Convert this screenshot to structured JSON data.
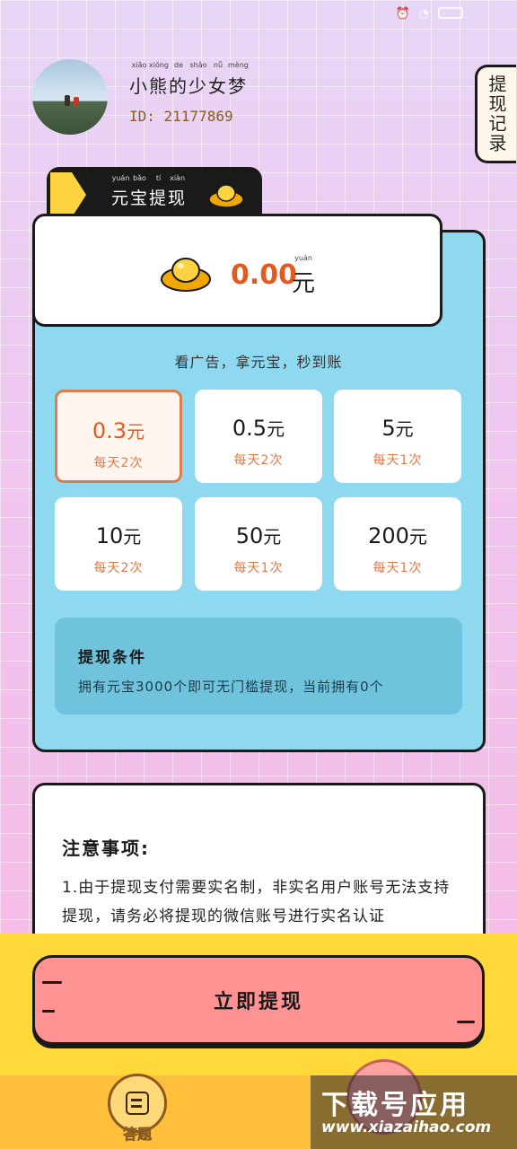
{
  "profile": {
    "name": "小熊的少女梦",
    "name_pinyin": [
      "xiǎo",
      "xióng",
      "de",
      "shǎo",
      "nǚ",
      "mèng"
    ],
    "id_label": "ID: 21177869"
  },
  "header": {
    "record_button": "提现记录"
  },
  "section": {
    "title": "元宝提现",
    "title_pinyin": [
      "yuán",
      "bǎo",
      "tí",
      "xiàn"
    ]
  },
  "balance": {
    "amount": "0.00",
    "unit": "元",
    "unit_pinyin": "yuán"
  },
  "slogan": "看广告，拿元宝，秒到账",
  "options": [
    {
      "amount": "0.3",
      "unit": "元",
      "freq": "每天2次",
      "selected": true
    },
    {
      "amount": "0.5",
      "unit": "元",
      "freq": "每天2次",
      "selected": false
    },
    {
      "amount": "5",
      "unit": "元",
      "freq": "每天1次",
      "selected": false
    },
    {
      "amount": "10",
      "unit": "元",
      "freq": "每天2次",
      "selected": false
    },
    {
      "amount": "50",
      "unit": "元",
      "freq": "每天1次",
      "selected": false
    },
    {
      "amount": "200",
      "unit": "元",
      "freq": "每天1次",
      "selected": false
    }
  ],
  "conditions": {
    "title": "提现条件",
    "text": "拥有元宝3000个即可无门槛提现，当前拥有0个"
  },
  "notes": {
    "title": "注意事项:",
    "text": "1.由于提现支付需要实名制，非实名用户账号无法支持提现，请务必将提现的微信账号进行实名认证"
  },
  "submit": {
    "label": "立即提现"
  },
  "tabbar": {
    "quiz_label": "答题"
  },
  "watermark": {
    "title": "下载号应用",
    "url": "www.xiazaihao.com"
  },
  "colors": {
    "accent": "#e35a1e",
    "panel_blue": "#8fd9f0",
    "button_pink": "#ff9393",
    "band_yellow": "#ffd83a"
  }
}
